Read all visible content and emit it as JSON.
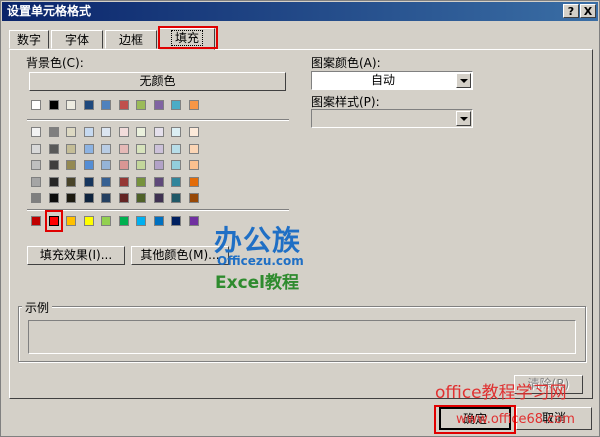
{
  "window": {
    "title": "设置单元格格式",
    "help_label": "?",
    "close_label": "X"
  },
  "tabs": [
    {
      "label": "数字"
    },
    {
      "label": "字体"
    },
    {
      "label": "边框"
    },
    {
      "label": "填充",
      "active": true
    }
  ],
  "fill": {
    "background_color_label": "背景色(C):",
    "no_color_label": "无颜色",
    "theme_row": [
      "#ffffff",
      "#000000",
      "#eeece1",
      "#1f497d",
      "#4f81bd",
      "#c0504d",
      "#9bbb59",
      "#8064a2",
      "#4bacc6",
      "#f79646"
    ],
    "tint_rows": [
      [
        "#f2f2f2",
        "#7f7f7f",
        "#ddd9c3",
        "#c6d9f0",
        "#dbe5f1",
        "#f2dcdb",
        "#ebf1dd",
        "#e5e0ec",
        "#dbeef3",
        "#fdeada"
      ],
      [
        "#d8d8d8",
        "#595959",
        "#c4bd97",
        "#8db3e2",
        "#b8cce4",
        "#e5b9b7",
        "#d7e3bc",
        "#ccc1d9",
        "#b7dde8",
        "#fbd5b5"
      ],
      [
        "#bfbfbf",
        "#3f3f3f",
        "#938953",
        "#548dd4",
        "#95b3d7",
        "#d99694",
        "#c3d69b",
        "#b2a2c7",
        "#92cddc",
        "#fac08f"
      ],
      [
        "#a5a5a5",
        "#262626",
        "#494429",
        "#17365d",
        "#366092",
        "#953734",
        "#76923c",
        "#5f497a",
        "#31859b",
        "#e36c09"
      ],
      [
        "#7f7f7f",
        "#0c0c0c",
        "#1d1b10",
        "#0f243e",
        "#244061",
        "#632423",
        "#4f6128",
        "#3f3151",
        "#205867",
        "#974806"
      ]
    ],
    "standard_row": [
      "#c00000",
      "#ff0000",
      "#ffc000",
      "#ffff00",
      "#92d050",
      "#00b050",
      "#00b0f0",
      "#0070c0",
      "#002060",
      "#7030a0"
    ],
    "selected_standard_index": 1,
    "fill_effects_label": "填充效果(I)...",
    "more_colors_label": "其他颜色(M)...",
    "pattern_color_label": "图案颜色(A):",
    "pattern_color_value": "自动",
    "pattern_style_label": "图案样式(P):",
    "pattern_style_value": "",
    "sample_label": "示例"
  },
  "buttons": {
    "clear_label": "清除(R)",
    "ok_label": "确定",
    "cancel_label": "取消"
  },
  "watermark": {
    "brand": "办公族",
    "brand_site": "Officezu.com",
    "brand_sub": "Excel教程",
    "site_text": "office教程学习网",
    "site_url": "www.office68.com"
  },
  "colors": {
    "highlight": "#e00000",
    "title_from": "#0a246a",
    "title_to": "#3a6ea5"
  }
}
